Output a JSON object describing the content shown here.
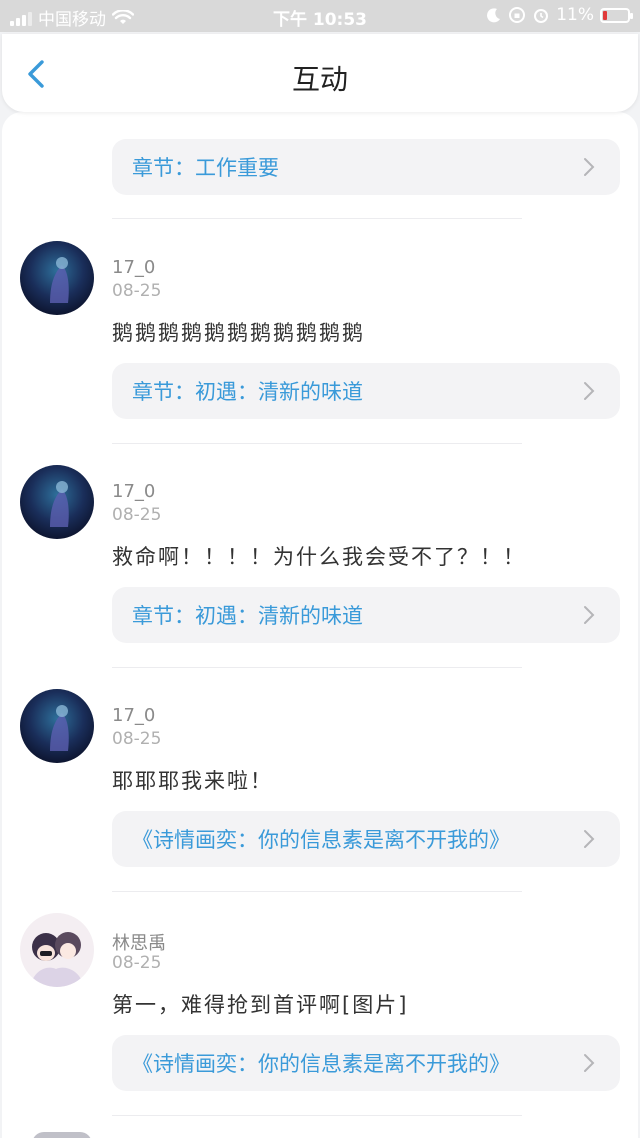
{
  "status_bar": {
    "carrier": "中国移动",
    "time": "下午 10:53",
    "battery_percent": "11%"
  },
  "nav": {
    "title": "互动"
  },
  "top_partial": {
    "chapter_label": "章节：工作重要"
  },
  "comments": [
    {
      "username": "17_0",
      "date": "08-25",
      "text": "鹅鹅鹅鹅鹅鹅鹅鹅鹅鹅鹅",
      "chapter_label": "章节：初遇：清新的味道",
      "avatar_style": "dark-blue"
    },
    {
      "username": "17_0",
      "date": "08-25",
      "text": "救命啊！！！！为什么我会受不了？！！",
      "chapter_label": "章节：初遇：清新的味道",
      "avatar_style": "dark-blue"
    },
    {
      "username": "17_0",
      "date": "08-25",
      "text": "耶耶耶我来啦！",
      "chapter_label": "《诗情画奕：你的信息素是离不开我的》",
      "avatar_style": "dark-blue"
    },
    {
      "username": "林思禹",
      "date": "08-25",
      "text": "第一，难得抢到首评啊[图片]",
      "chapter_label": "《诗情画奕：你的信息素是离不开我的》",
      "avatar_style": "anime-light"
    }
  ],
  "colors": {
    "accent": "#3a9ad9",
    "username": "#8a8a8a",
    "date": "#b0b0b0",
    "text": "#333333",
    "chip_bg": "#f3f3f5"
  }
}
